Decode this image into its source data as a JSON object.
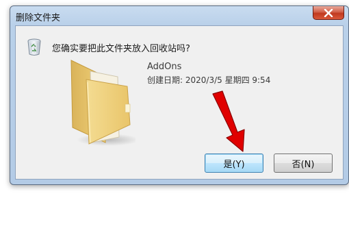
{
  "dialog": {
    "title": "删除文件夹",
    "question": "您确实要把此文件夹放入回收站吗?",
    "file": {
      "name": "AddOns",
      "date": "创建日期: 2020/3/5 星期四 9:54"
    },
    "buttons": {
      "yes": "是(Y)",
      "no": "否(N)"
    }
  },
  "icons": {
    "close": "close-icon",
    "recycle": "recycle-bin-icon",
    "folder": "folder-icon",
    "arrow": "red-arrow-icon"
  },
  "colors": {
    "frame": "#b9d0e9",
    "close_button": "#c0391f",
    "default_button": "#a7d9f5",
    "arrow": "#e00000",
    "folder": "#f2d27a"
  }
}
